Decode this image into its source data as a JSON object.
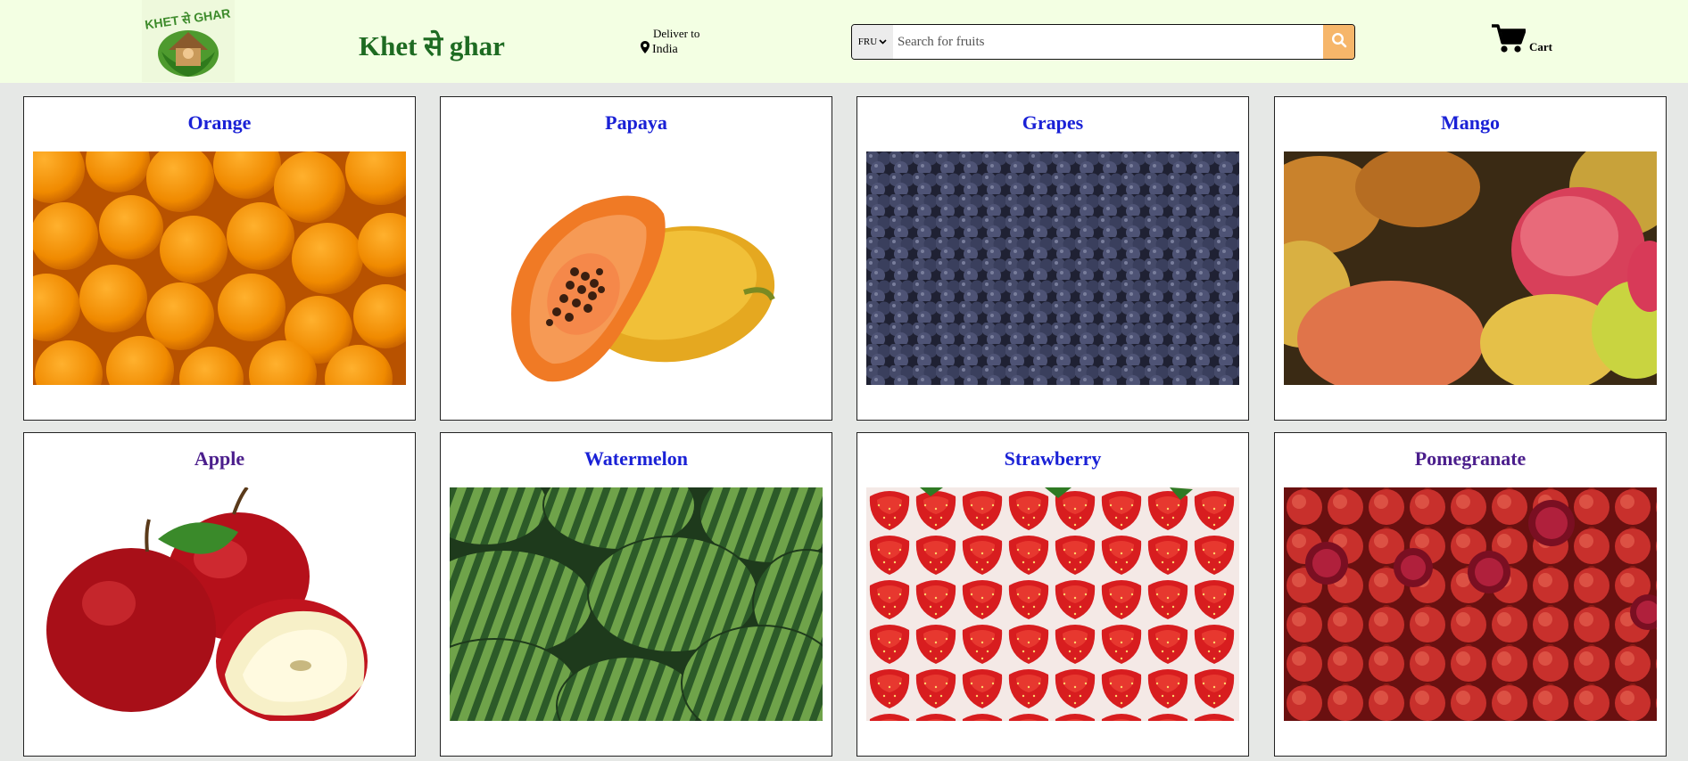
{
  "header": {
    "logo_text": "KHET से GHAR",
    "brand": "Khet से ghar",
    "deliver_line1": "Deliver to",
    "deliver_line2": "India",
    "search": {
      "category": "FRU",
      "placeholder": "Search for fruits"
    },
    "cart_label": "Cart"
  },
  "products": [
    {
      "name": "Orange"
    },
    {
      "name": "Papaya"
    },
    {
      "name": "Grapes"
    },
    {
      "name": "Mango"
    },
    {
      "name": "Apple"
    },
    {
      "name": "Watermelon"
    },
    {
      "name": "Strawberry"
    },
    {
      "name": "Pomegranate"
    }
  ],
  "colors": {
    "header_bg": "#f3ffe3",
    "brand_green": "#1e6b22",
    "title_blue": "#1a21d6",
    "title_visited": "#4b1e8c",
    "search_button": "#f6b66a"
  }
}
